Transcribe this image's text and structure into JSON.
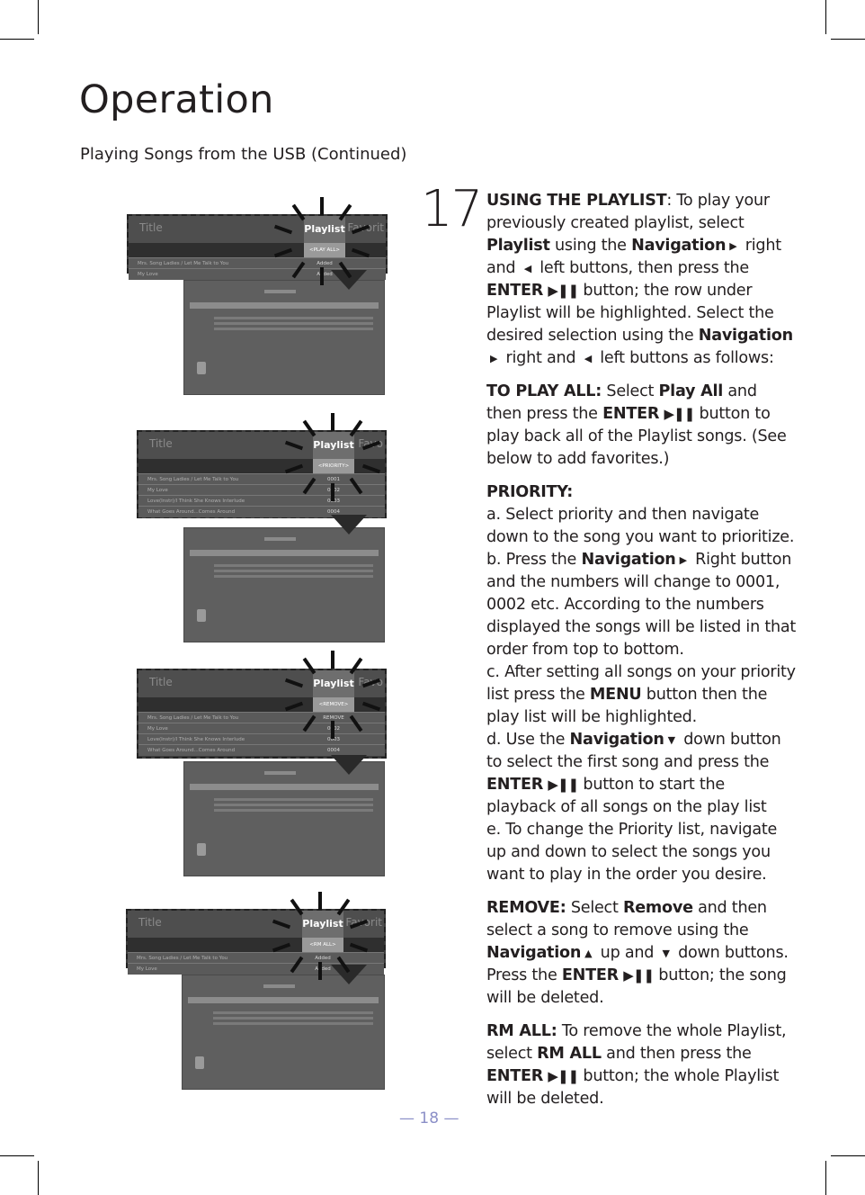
{
  "page": {
    "title": "Operation",
    "subtitle": "Playing Songs from the USB (Continued)",
    "page_number": "— 18 —"
  },
  "step": {
    "number": "17",
    "intro": {
      "heading": "USING THE PLAYLIST",
      "t1": ": To play your previously created playlist, select ",
      "b1": "Playlist",
      "t2": " using the ",
      "b2": "Navigation",
      "t3": " right and ",
      "t4": " left buttons, then press the ",
      "b3": "ENTER",
      "t5": " button; the row under Playlist will be highlighted. Select the desired selection using the ",
      "b4": "Navigation",
      "t6": " right and ",
      "t7": " left buttons as follows:"
    },
    "play_all": {
      "heading": "TO PLAY ALL:",
      "t1": " Select ",
      "b1": "Play All",
      "t2": " and then press the ",
      "b2": "ENTER",
      "t3": " button to play back all of the Playlist songs. (See below to add favorites.)"
    },
    "priority": {
      "heading": "PRIORITY:",
      "a": "a. Select priority and then navigate down to the song you want to prioritize.",
      "b_t1": "b. Press the ",
      "b_b1": "Navigation",
      "b_t2": " Right button and the numbers will change to 0001, 0002 etc. According to the numbers displayed the songs will be listed in that order from top to bottom.",
      "c_t1": "c.  After setting all songs on your priority list press the ",
      "c_b1": "MENU",
      "c_t2": " button then the play list will be highlighted.",
      "d_t1": "d. Use the ",
      "d_b1": "Navigation",
      "d_t2": " down button to select the first song and press the ",
      "d_b2": "ENTER",
      "d_t3": " button to start the playback of all songs on the play list",
      "e": "e. To change the Priority list, navigate up and down to select the songs you want to play in the order you desire."
    },
    "remove": {
      "heading": "REMOVE:",
      "t1": " Select ",
      "b1": "Remove",
      "t2": " and then select a song to remove using the ",
      "b2": "Navigation",
      "t3": " up and ",
      "t4": " down buttons. Press the ",
      "b3": "ENTER",
      "t5": " button; the song will be deleted."
    },
    "rm_all": {
      "heading": "RM ALL:",
      "t1": " To remove the whole Playlist, select ",
      "b1": "RM ALL",
      "t2": " and then press the ",
      "b2": "ENTER",
      "t3": " button; the whole Playlist will be deleted."
    }
  },
  "glyphs": {
    "right": "▶",
    "left": "◀",
    "up": "▲",
    "down": "▼",
    "play_pause": "▶❚❚"
  },
  "screenshots": [
    {
      "menu_title": "Title",
      "column": "Playlist",
      "next_column": "Favorit",
      "selected_option": "<PLAY ALL>",
      "rows": [
        {
          "song": "Mrs. Song Ladies / Let Me Talk to You",
          "value": "Added"
        },
        {
          "song": "My Love",
          "value": "Added"
        }
      ]
    },
    {
      "menu_title": "Title",
      "column": "Playlist",
      "next_column": "Favo",
      "selected_option": "<PRIORITY>",
      "rows": [
        {
          "song": "Mrs. Song Ladies / Let Me Talk to You",
          "value": "0001"
        },
        {
          "song": "My Love",
          "value": "0002"
        },
        {
          "song": "Love(Instr)/I Think She Knows Interlude",
          "value": "0003"
        },
        {
          "song": "What Goes Around...Comes Around",
          "value": "0004"
        }
      ]
    },
    {
      "menu_title": "Title",
      "column": "Playlist",
      "next_column": "Favo",
      "selected_option": "<REMOVE>",
      "rows": [
        {
          "song": "Mrs. Song Ladies / Let Me Talk to You",
          "value": "REMOVE"
        },
        {
          "song": "My Love",
          "value": "0002"
        },
        {
          "song": "Love(Instr)/I Think She Knows Interlude",
          "value": "0003"
        },
        {
          "song": "What Goes Around...Comes Around",
          "value": "0004"
        }
      ]
    },
    {
      "menu_title": "Title",
      "column": "Playlist",
      "next_column": "Favorit",
      "selected_option": "<RM ALL>",
      "rows": [
        {
          "song": "Mrs. Song Ladies / Let Me Talk to You",
          "value": "Added"
        },
        {
          "song": "My Love",
          "value": "Added"
        }
      ]
    }
  ]
}
